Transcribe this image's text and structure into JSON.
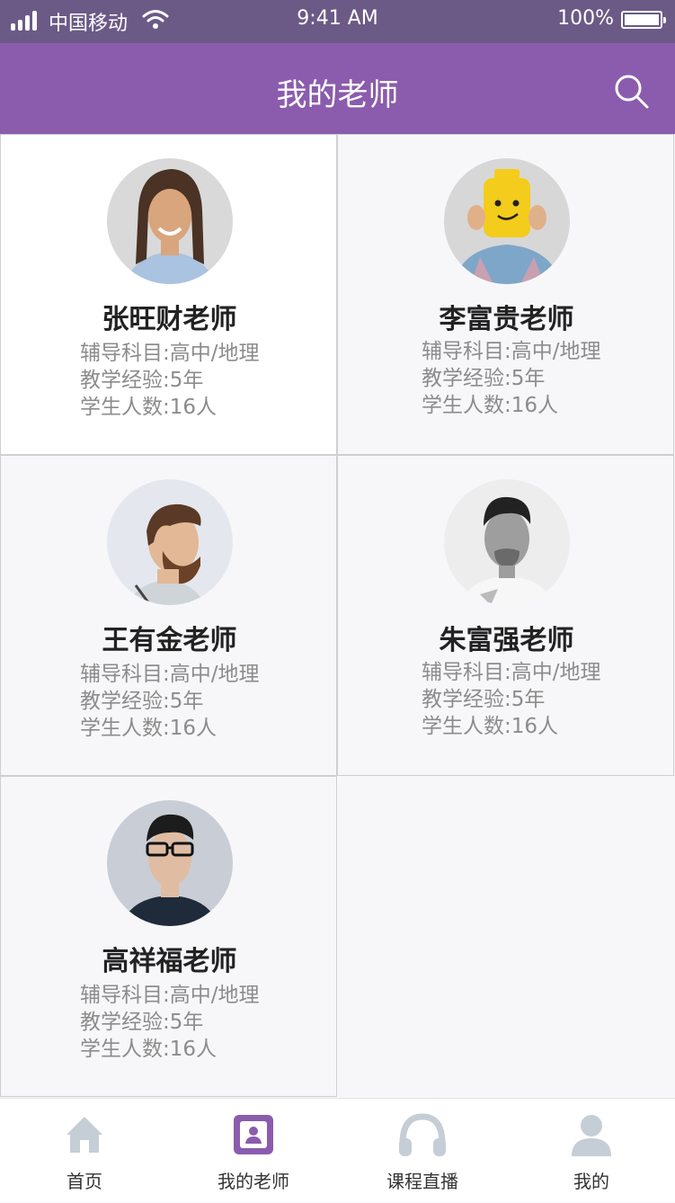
{
  "status_bar": {
    "carrier": "中国移动",
    "time": "9:41 AM",
    "battery_percent": "100%"
  },
  "nav": {
    "title": "我的老师",
    "search_icon": "search-icon"
  },
  "teachers": [
    {
      "name": "张旺财老师",
      "subject": "辅导科目:高中/地理",
      "experience": "教学经验:5年",
      "students": "学生人数:16人",
      "avatar": "avatar-long-hair-man"
    },
    {
      "name": "李富贵老师",
      "subject": "辅导科目:高中/地理",
      "experience": "教学经验:5年",
      "students": "学生人数:16人",
      "avatar": "avatar-lego-head"
    },
    {
      "name": "王有金老师",
      "subject": "辅导科目:高中/地理",
      "experience": "教学经验:5年",
      "students": "学生人数:16人",
      "avatar": "avatar-bearded-man"
    },
    {
      "name": "朱富强老师",
      "subject": "辅导科目:高中/地理",
      "experience": "教学经验:5年",
      "students": "学生人数:16人",
      "avatar": "avatar-mustache-man"
    },
    {
      "name": "高祥福老师",
      "subject": "辅导科目:高中/地理",
      "experience": "教学经验:5年",
      "students": "学生人数:16人",
      "avatar": "avatar-glasses-man"
    }
  ],
  "tabs": [
    {
      "label": "首页",
      "icon": "home-icon",
      "active": false
    },
    {
      "label": "我的老师",
      "icon": "teacher-icon",
      "active": true
    },
    {
      "label": "课程直播",
      "icon": "headphones-icon",
      "active": false
    },
    {
      "label": "我的",
      "icon": "user-icon",
      "active": false
    }
  ],
  "colors": {
    "status_bar": "#6b5a86",
    "nav_bar": "#8b5cad",
    "accent": "#8b5cad",
    "inactive_icon": "#c5ced6"
  }
}
